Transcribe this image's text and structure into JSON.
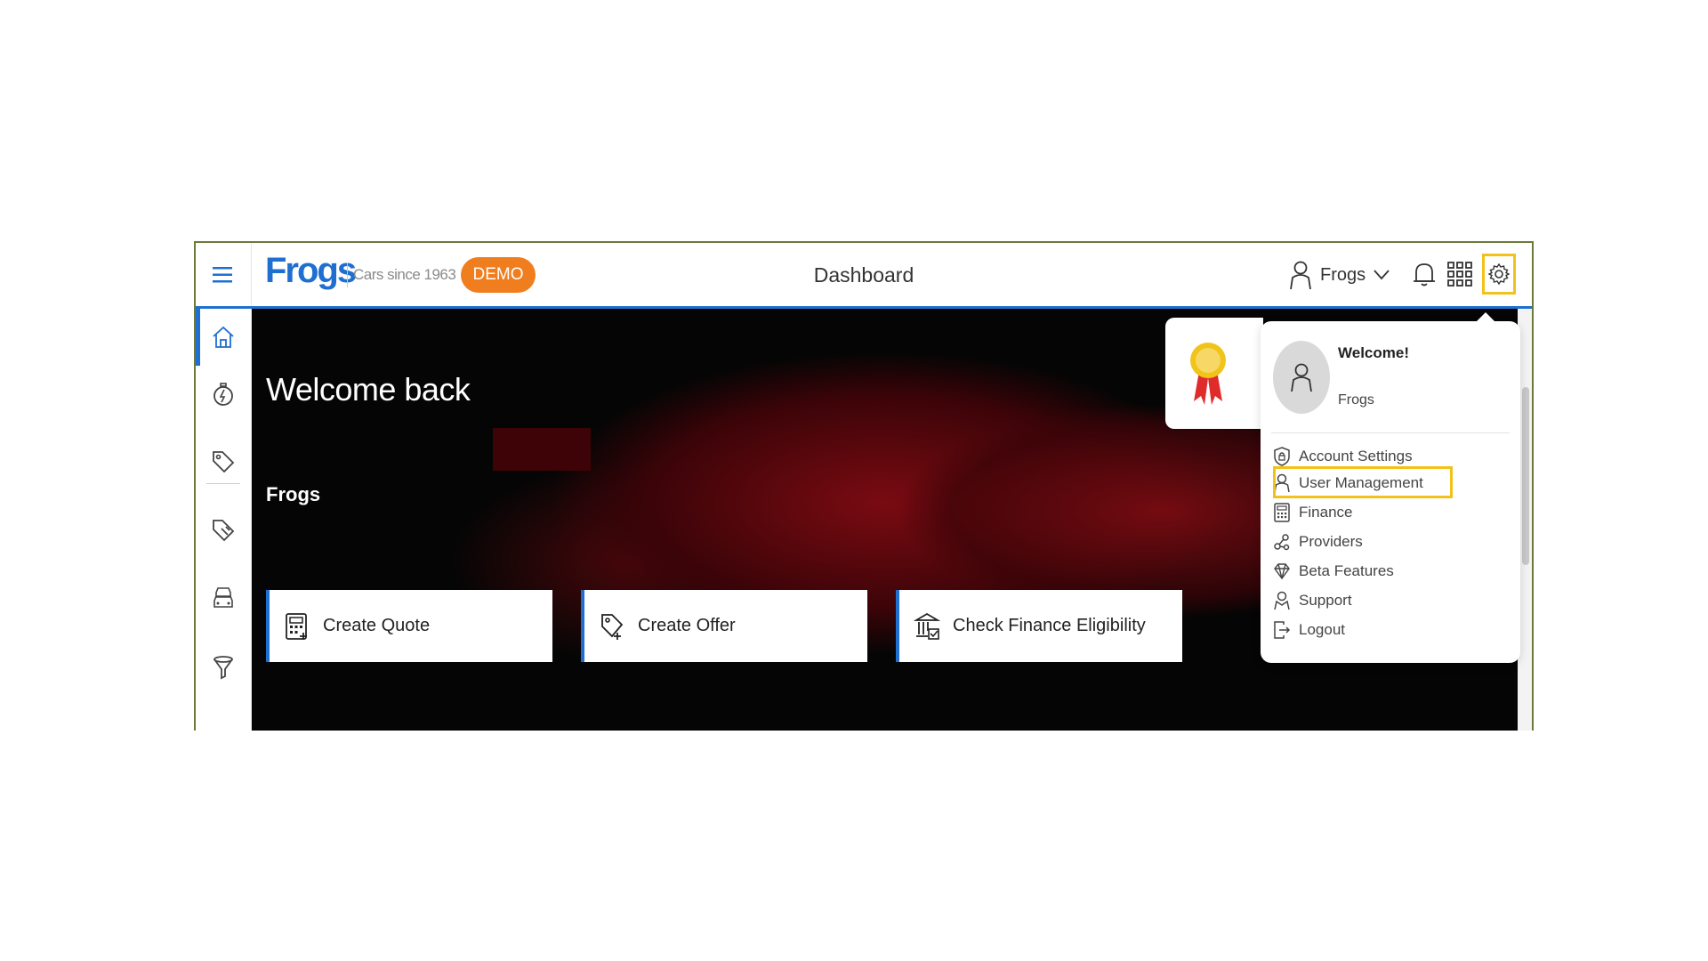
{
  "header": {
    "logo": "Frogs",
    "tagline": "Cars since 1963",
    "demo_badge": "DEMO",
    "title": "Dashboard",
    "user_label": "Frogs"
  },
  "hero": {
    "welcome": "Welcome back",
    "name": "Frogs"
  },
  "actions": [
    {
      "label": "Create Quote",
      "icon": "calculator-icon"
    },
    {
      "label": "Create Offer",
      "icon": "tag-plus-icon"
    },
    {
      "label": "Check Finance Eligibility",
      "icon": "bank-check-icon"
    }
  ],
  "sidebar": {
    "items": [
      "home-icon",
      "stopwatch-icon",
      "tag-icon",
      "wrench-tag-icon",
      "cars-icon",
      "funnel-icon"
    ]
  },
  "settings_menu": {
    "welcome": "Welcome!",
    "user_name": "Frogs",
    "items": [
      {
        "label": "Account Settings",
        "icon": "shield-lock-icon"
      },
      {
        "label": "User Management",
        "icon": "user-icon"
      },
      {
        "label": "Finance",
        "icon": "calculator-icon"
      },
      {
        "label": "Providers",
        "icon": "network-icon"
      },
      {
        "label": "Beta Features",
        "icon": "diamond-icon"
      },
      {
        "label": "Support",
        "icon": "support-user-icon"
      },
      {
        "label": "Logout",
        "icon": "logout-icon"
      }
    ]
  },
  "colors": {
    "accent": "#1f6fd1",
    "demo": "#f07e1f",
    "highlight": "#f3c11b"
  }
}
